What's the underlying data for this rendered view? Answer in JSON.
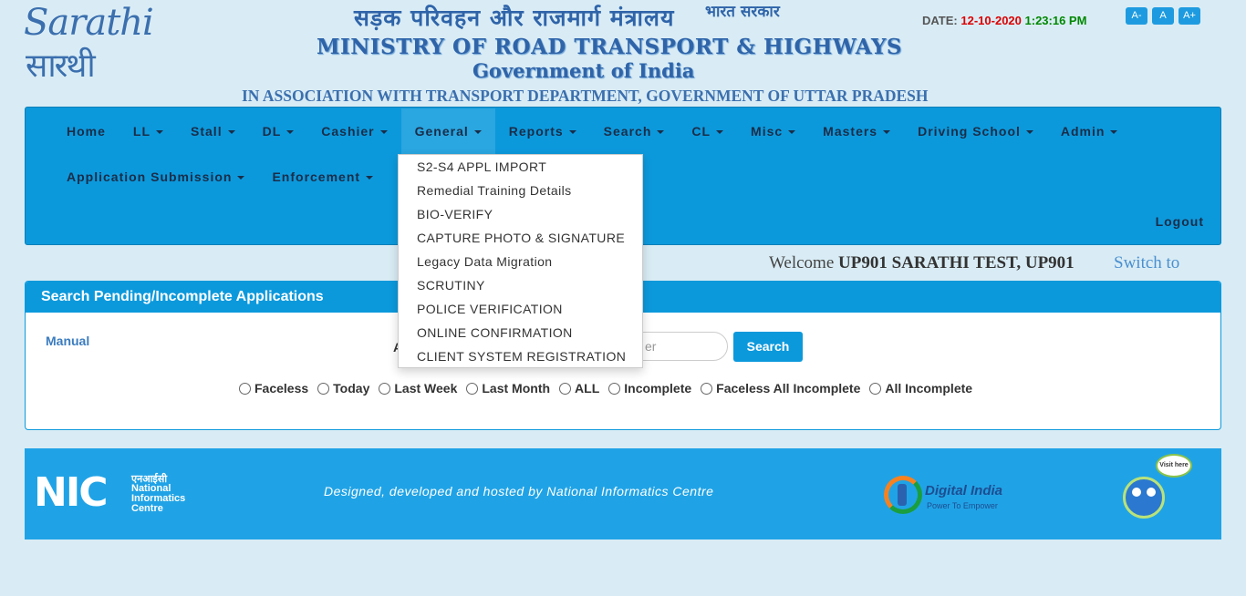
{
  "header": {
    "logo_top": "Sarathi",
    "logo_bottom": "सारथी",
    "hindi_title": "सड़क परिवहन और राजमार्ग मंत्रालय",
    "hindi_sub": "भारत सरकार",
    "ministry": "MINISTRY OF ROAD TRANSPORT & HIGHWAYS",
    "govt": "Government of India",
    "association": "IN ASSOCIATION WITH TRANSPORT DEPARTMENT, GOVERNMENT OF UTTAR PRADESH",
    "date_label": "DATE:",
    "date_value": "12-10-2020",
    "time_value": "1:23:16 PM",
    "font_buttons": [
      "A-",
      "A",
      "A+"
    ]
  },
  "nav": {
    "row1": [
      {
        "label": "Home",
        "caret": false
      },
      {
        "label": "LL",
        "caret": true
      },
      {
        "label": "Stall",
        "caret": true
      },
      {
        "label": "DL",
        "caret": true
      },
      {
        "label": "Cashier",
        "caret": true
      },
      {
        "label": "General",
        "caret": true,
        "active": true
      },
      {
        "label": "Reports",
        "caret": true
      },
      {
        "label": "Search",
        "caret": true
      },
      {
        "label": "CL",
        "caret": true
      },
      {
        "label": "Misc",
        "caret": true
      },
      {
        "label": "Masters",
        "caret": true
      },
      {
        "label": "Driving School",
        "caret": true
      },
      {
        "label": "Admin",
        "caret": true
      }
    ],
    "row2": [
      {
        "label": "Application Submission",
        "caret": true
      },
      {
        "label": "Enforcement",
        "caret": true
      }
    ],
    "logout": "Logout"
  },
  "dropdown": {
    "items": [
      "S2-S4 APPL IMPORT",
      "Remedial Training Details",
      "BIO-VERIFY",
      "CAPTURE PHOTO & SIGNATURE",
      "Legacy Data Migration",
      "SCRUTINY",
      "POLICE VERIFICATION",
      "ONLINE CONFIRMATION",
      "CLIENT SYSTEM REGISTRATION"
    ]
  },
  "welcome": {
    "prefix": "Welcome",
    "user": "UP901 SARATHI TEST, UP901",
    "switch": "Switch to"
  },
  "panel": {
    "title": "Search Pending/Incomplete Applications",
    "manual": "Manual",
    "app_label": "A",
    "input_placeholder": "er",
    "search_button": "Search",
    "radios": [
      "Faceless",
      "Today",
      "Last Week",
      "Last Month",
      "ALL",
      "Incomplete",
      "Faceless All Incomplete",
      "All Incomplete"
    ]
  },
  "footer": {
    "nic_big": "NIC",
    "nic_hindi": "एनआईसी",
    "nic_name_1": "National",
    "nic_name_2": "Informatics",
    "nic_name_3": "Centre",
    "designed": "Designed, developed and hosted by National Informatics Centre",
    "digital_india": "Digital India",
    "digital_india_sub": "Power To Empower",
    "mascot_bubble": "Visit here"
  }
}
